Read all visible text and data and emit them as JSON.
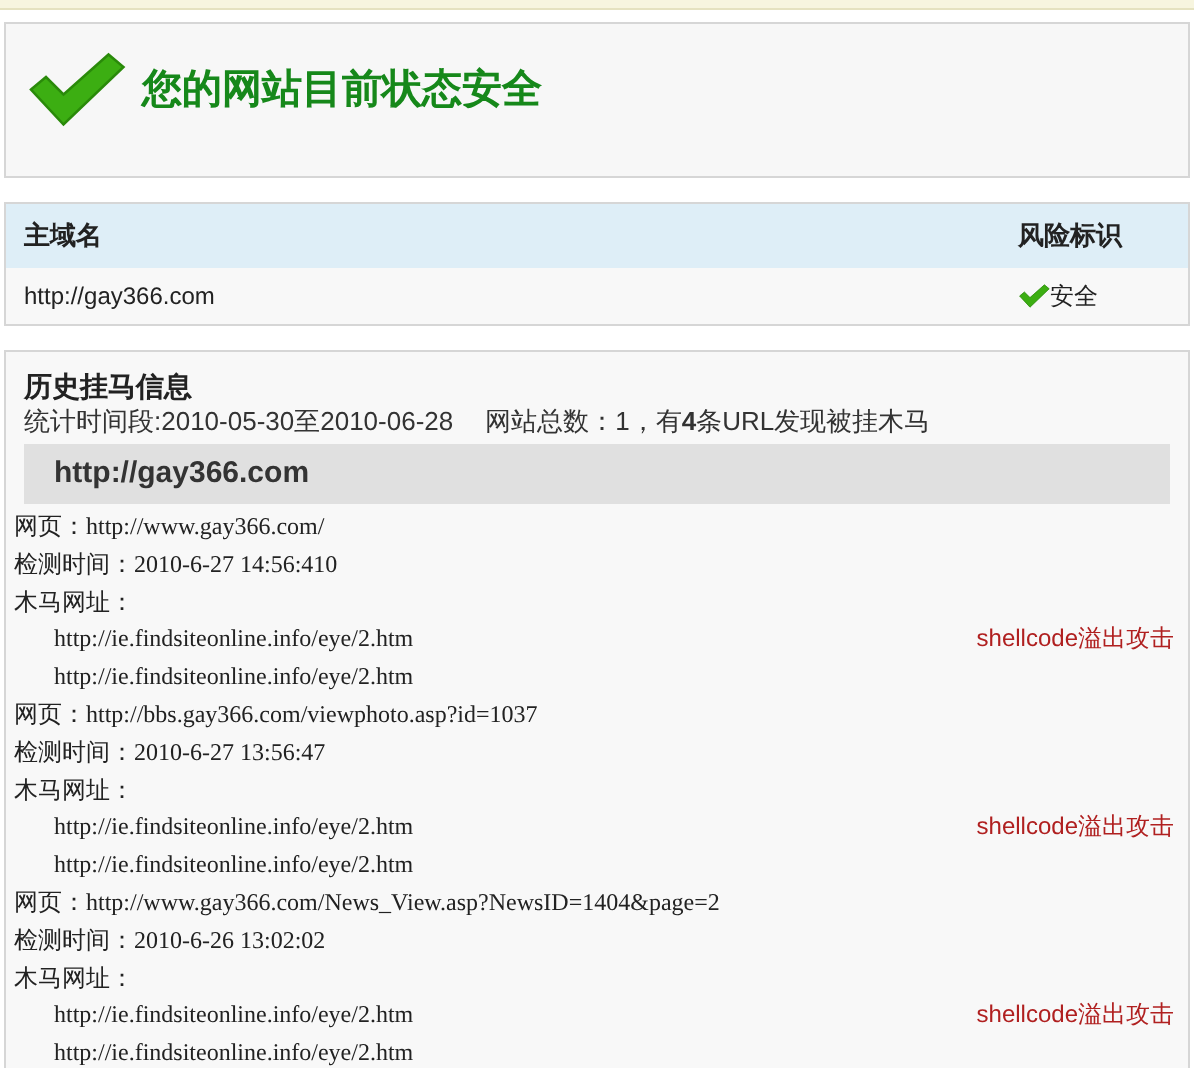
{
  "status": {
    "title": "您的网站目前状态安全"
  },
  "domain_table": {
    "columns": [
      "主域名",
      "风险标识"
    ],
    "rows": [
      {
        "domain": "http://gay366.com",
        "risk": "安全"
      }
    ]
  },
  "history": {
    "title": "历史挂马信息",
    "summary_prefix": "统计时间段:2010-05-30至2010-06-28",
    "summary": "网站总数：1，有**4**条URL发现被挂木马",
    "site": "http://gay366.com",
    "records": [
      {
        "page": "网页：http://www.gay366.com/",
        "time": "检测时间：2010-6-27 14:56:410",
        "trojan_label": "木马网址：",
        "trojans": [
          {
            "url": "http://ie.findsiteonline.info/eye/2.htm",
            "attack": "shellcode溢出攻击"
          },
          {
            "url": "http://ie.findsiteonline.info/eye/2.htm"
          }
        ]
      },
      {
        "page": "网页：http://bbs.gay366.com/viewphoto.asp?id=1037",
        "time": "检测时间：2010-6-27 13:56:47",
        "trojan_label": "木马网址：",
        "trojans": [
          {
            "url": "http://ie.findsiteonline.info/eye/2.htm",
            "attack": "shellcode溢出攻击"
          },
          {
            "url": "http://ie.findsiteonline.info/eye/2.htm"
          }
        ]
      },
      {
        "page": "网页：http://www.gay366.com/News_View.asp?NewsID=1404&page=2",
        "time": "检测时间：2010-6-26 13:02:02",
        "trojan_label": "木马网址：",
        "trojans": [
          {
            "url": "http://ie.findsiteonline.info/eye/2.htm",
            "attack": "shellcode溢出攻击"
          },
          {
            "url": "http://ie.findsiteonline.info/eye/2.htm"
          }
        ]
      }
    ]
  }
}
